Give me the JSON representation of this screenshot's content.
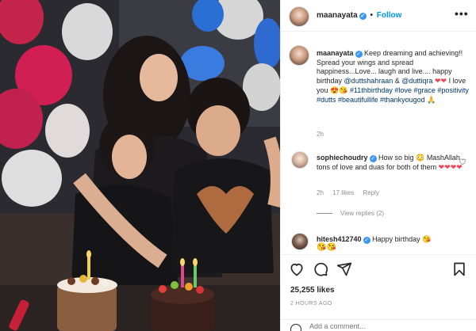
{
  "post": {
    "username": "maanayata",
    "verified_mark": "✓",
    "follow_label": "Follow",
    "more_label": "•••"
  },
  "caption": {
    "username": "maanayata",
    "text_1": "Keep dreaming and achieving!! Spread your wings and spread happiness...Love... laugh and live.... happy birthday",
    "mention_1": "@duttshahraan",
    "amp": "&",
    "mention_2": "@duttiqra",
    "hearts": "❤❤",
    "text_2": "I love you",
    "emojis": "😍😘",
    "hashtags": "#11thbirthday #love #grace #positivity #dutts #beautifullife #thankyougod",
    "pray": "🙏",
    "time": "2h"
  },
  "comments": [
    {
      "username": "sophiechoudry",
      "text": "How so big",
      "emoji": "😳",
      "text_2": "MashAllah .. tons of love and duas for both of them",
      "hearts": "❤❤❤❤",
      "time": "2h",
      "likes": "17 likes",
      "reply_label": "Reply",
      "view_replies": "View replies (2)"
    },
    {
      "username": "hitesh412740",
      "text": "Happy birthday",
      "emoji": "😘",
      "emoji_row": "😘😘"
    }
  ],
  "actions": {
    "likes": "25,255 likes",
    "time_ago": "2 HOURS AGO",
    "add_comment_placeholder": "Add a comment..."
  },
  "colors": {
    "link": "#0095f6",
    "hashtag": "#00376b",
    "verified": "#3897f0",
    "heart": "#ed4956",
    "muted": "#8e8e8e"
  },
  "icons": [
    "heart-icon",
    "comment-icon",
    "share-icon",
    "bookmark-icon",
    "emoji-icon",
    "more-icon",
    "verified-icon"
  ]
}
